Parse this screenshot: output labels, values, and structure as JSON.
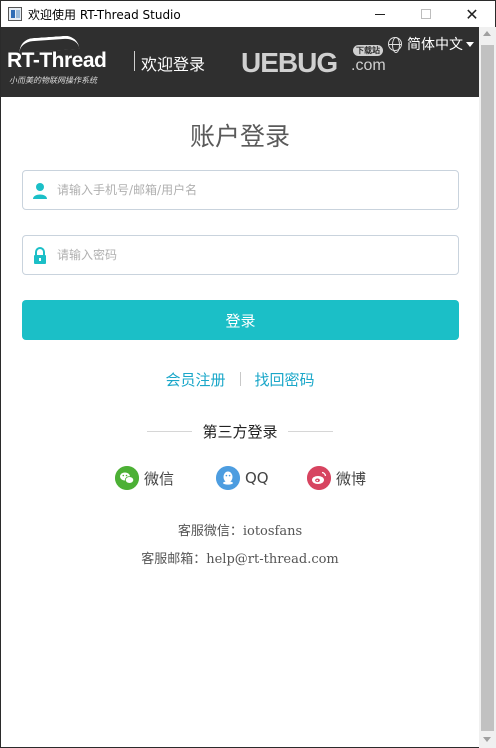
{
  "window": {
    "title": "欢迎使用 RT-Thread Studio",
    "close_glyph": "✕"
  },
  "header": {
    "logo_text": "RT-Thread",
    "logo_tagline": "小而美的物联网操作系统",
    "welcome": "欢迎登录",
    "language": "简体中文"
  },
  "watermark": {
    "text": "UEBUG",
    "suffix": ".com",
    "tag": "下载站"
  },
  "login": {
    "title": "账户登录",
    "username_placeholder": "请输入手机号/邮箱/用户名",
    "password_placeholder": "请输入密码",
    "submit_label": "登录",
    "register_label": "会员注册",
    "recover_label": "找回密码",
    "third_party_label": "第三方登录"
  },
  "social": {
    "wechat": "微信",
    "qq": "QQ",
    "weibo": "微博"
  },
  "contact": {
    "wechat_line": "客服微信：iotosfans",
    "email_line": "客服邮箱：help@rt-thread.com"
  },
  "colors": {
    "accent": "#1bbfc7",
    "link": "#1aa7c9",
    "header_bg": "#2f2f2f",
    "wechat": "#4cb035",
    "qq": "#4d9de0",
    "weibo": "#d74460"
  },
  "icons": {
    "app": "app-window-icon",
    "language": "globe-icon",
    "username": "user-icon",
    "password": "lock-icon",
    "wechat": "wechat-icon",
    "qq": "qq-icon",
    "weibo": "weibo-icon"
  }
}
